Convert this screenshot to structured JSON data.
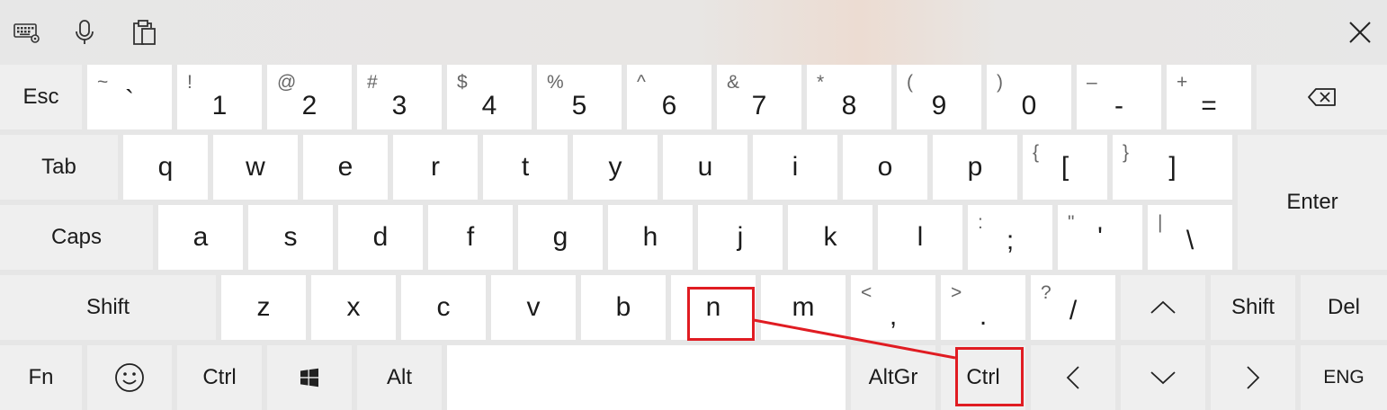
{
  "toolbar": {
    "icons": [
      "keyboard-settings-icon",
      "microphone-icon",
      "clipboard-icon"
    ],
    "close_icon": "close-icon"
  },
  "row1": [
    {
      "primary": "Esc",
      "func": true
    },
    {
      "primary": "`",
      "secondary": "~"
    },
    {
      "primary": "1",
      "secondary": "!"
    },
    {
      "primary": "2",
      "secondary": "@"
    },
    {
      "primary": "3",
      "secondary": "#"
    },
    {
      "primary": "4",
      "secondary": "$"
    },
    {
      "primary": "5",
      "secondary": "%"
    },
    {
      "primary": "6",
      "secondary": "^"
    },
    {
      "primary": "7",
      "secondary": "&"
    },
    {
      "primary": "8",
      "secondary": "*"
    },
    {
      "primary": "9",
      "secondary": "("
    },
    {
      "primary": "0",
      "secondary": ")"
    },
    {
      "primary": "-",
      "secondary": "–"
    },
    {
      "primary": "=",
      "secondary": "+"
    },
    {
      "icon": "backspace-icon"
    }
  ],
  "row2": [
    {
      "primary": "Tab"
    },
    {
      "primary": "q"
    },
    {
      "primary": "w"
    },
    {
      "primary": "e"
    },
    {
      "primary": "r"
    },
    {
      "primary": "t"
    },
    {
      "primary": "y"
    },
    {
      "primary": "u"
    },
    {
      "primary": "i"
    },
    {
      "primary": "o"
    },
    {
      "primary": "p"
    },
    {
      "primary": "[",
      "secondary": "{"
    },
    {
      "primary": "]",
      "secondary": "}"
    },
    {
      "primary": "Enter"
    }
  ],
  "row3": [
    {
      "primary": "Caps"
    },
    {
      "primary": "a"
    },
    {
      "primary": "s"
    },
    {
      "primary": "d"
    },
    {
      "primary": "f"
    },
    {
      "primary": "g"
    },
    {
      "primary": "h"
    },
    {
      "primary": "j"
    },
    {
      "primary": "k"
    },
    {
      "primary": "l"
    },
    {
      "primary": ";",
      "secondary": ":"
    },
    {
      "primary": "'",
      "secondary": "\""
    },
    {
      "primary": "\\",
      "secondary": "|"
    }
  ],
  "row4": [
    {
      "primary": "Shift"
    },
    {
      "primary": "z"
    },
    {
      "primary": "x"
    },
    {
      "primary": "c"
    },
    {
      "primary": "v"
    },
    {
      "primary": "b"
    },
    {
      "primary": "n"
    },
    {
      "primary": "m"
    },
    {
      "primary": ",",
      "secondary": "<"
    },
    {
      "primary": ".",
      "secondary": ">"
    },
    {
      "primary": "/",
      "secondary": "?"
    },
    {
      "icon": "arrow-up-icon"
    },
    {
      "primary": "Shift"
    },
    {
      "primary": "Del"
    }
  ],
  "row5": [
    {
      "primary": "Fn"
    },
    {
      "icon": "emoji-icon"
    },
    {
      "primary": "Ctrl"
    },
    {
      "icon": "windows-logo-icon"
    },
    {
      "primary": "Alt"
    },
    {
      "icon": "space-bar"
    },
    {
      "primary": "AltGr"
    },
    {
      "primary": "Ctrl"
    },
    {
      "icon": "arrow-left-icon"
    },
    {
      "icon": "arrow-down-icon"
    },
    {
      "icon": "arrow-right-icon"
    },
    {
      "primary": "ENG"
    }
  ],
  "highlight": {
    "color": "#e01c22",
    "from_key": "n",
    "to_key": "Ctrl"
  }
}
